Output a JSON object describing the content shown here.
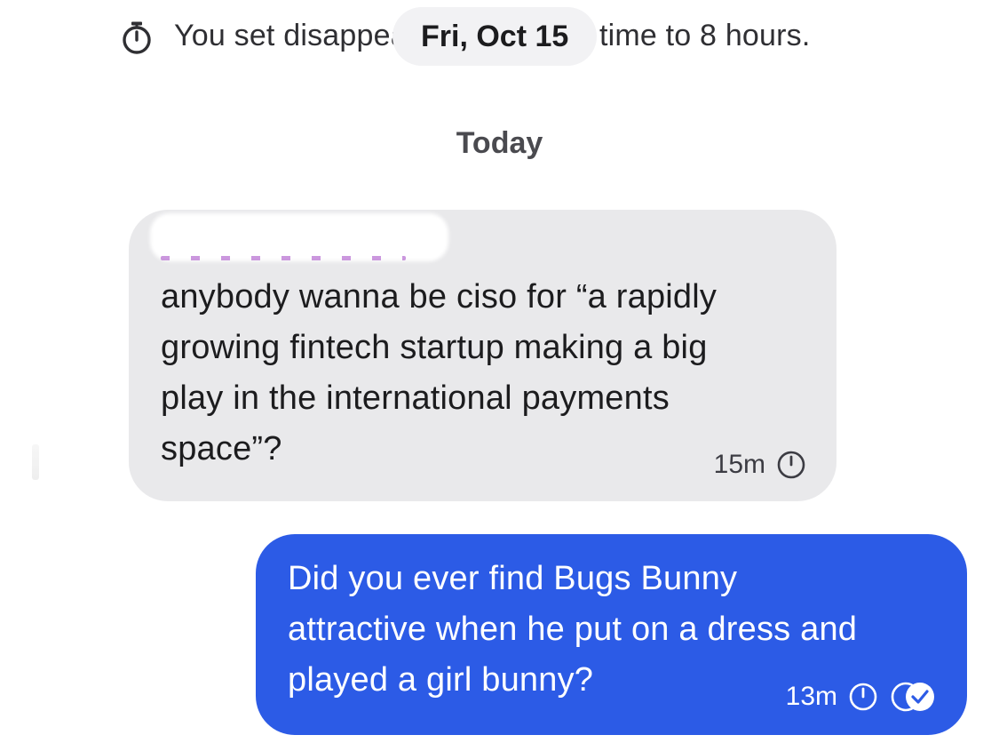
{
  "system_notice": {
    "text": "You set disappearing message time to 8 hours.",
    "icon": "stopwatch-icon"
  },
  "date_pill": {
    "label": "Fri, Oct 15"
  },
  "section_header": {
    "label": "Today"
  },
  "messages": [
    {
      "direction": "incoming",
      "text": "anybody wanna be ciso for “a rapidly\ngrowing fintech startup making a big\nplay in the international payments\nspace”?",
      "time": "15m",
      "icon": "disappearing-timer-icon"
    },
    {
      "direction": "outgoing",
      "text": "Did you ever find Bugs Bunny\nattractive when he put on a dress and\nplayed a girl bunny?",
      "time": "13m",
      "icons": [
        "disappearing-timer-icon",
        "delivered-read-icon"
      ]
    }
  ],
  "colors": {
    "incoming_bubble": "#e9e9eb",
    "outgoing_bubble": "#2c5be6",
    "date_pill": "#f2f2f4"
  }
}
